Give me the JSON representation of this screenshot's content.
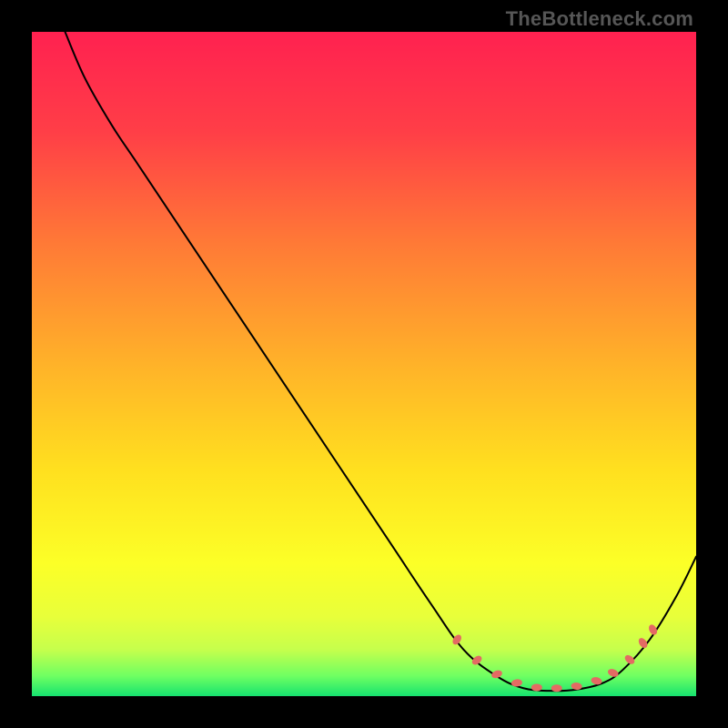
{
  "watermark": "TheBottleneck.com",
  "plot_size": 730,
  "chart_data": {
    "type": "line",
    "title": "",
    "xlabel": "",
    "ylabel": "",
    "xlim": [
      0,
      100
    ],
    "ylim": [
      0,
      100
    ],
    "grid": false,
    "background_gradient": [
      {
        "pct": 0.0,
        "color": "#ff2150"
      },
      {
        "pct": 0.15,
        "color": "#ff3e47"
      },
      {
        "pct": 0.32,
        "color": "#ff7a36"
      },
      {
        "pct": 0.5,
        "color": "#ffb229"
      },
      {
        "pct": 0.66,
        "color": "#ffe01f"
      },
      {
        "pct": 0.8,
        "color": "#fcff27"
      },
      {
        "pct": 0.88,
        "color": "#e8ff3a"
      },
      {
        "pct": 0.93,
        "color": "#c6ff4c"
      },
      {
        "pct": 0.97,
        "color": "#6eff62"
      },
      {
        "pct": 1.0,
        "color": "#16e36f"
      }
    ],
    "series": [
      {
        "name": "curve",
        "color": "#000000",
        "width": 2,
        "points": [
          {
            "x": 5.0,
            "y": 100.0
          },
          {
            "x": 8.0,
            "y": 93.0
          },
          {
            "x": 12.0,
            "y": 86.0
          },
          {
            "x": 16.0,
            "y": 80.0
          },
          {
            "x": 22.0,
            "y": 71.0
          },
          {
            "x": 30.0,
            "y": 59.0
          },
          {
            "x": 38.0,
            "y": 47.0
          },
          {
            "x": 46.0,
            "y": 35.0
          },
          {
            "x": 54.0,
            "y": 23.0
          },
          {
            "x": 60.0,
            "y": 14.0
          },
          {
            "x": 65.0,
            "y": 7.0
          },
          {
            "x": 70.0,
            "y": 3.0
          },
          {
            "x": 74.0,
            "y": 1.2
          },
          {
            "x": 78.0,
            "y": 0.8
          },
          {
            "x": 82.0,
            "y": 1.0
          },
          {
            "x": 86.0,
            "y": 2.0
          },
          {
            "x": 89.0,
            "y": 4.0
          },
          {
            "x": 93.0,
            "y": 8.5
          },
          {
            "x": 97.0,
            "y": 15.0
          },
          {
            "x": 100.0,
            "y": 21.0
          }
        ]
      }
    ],
    "markers": {
      "name": "dotted-bottom",
      "color": "#e46a63",
      "rx": 6,
      "ry": 4,
      "rotations": [
        -55,
        -40,
        -20,
        -8,
        0,
        0,
        5,
        12,
        22,
        40,
        55,
        62
      ],
      "points": [
        {
          "x": 64.0,
          "y": 8.5
        },
        {
          "x": 67.0,
          "y": 5.4
        },
        {
          "x": 70.0,
          "y": 3.3
        },
        {
          "x": 73.0,
          "y": 2.0
        },
        {
          "x": 76.0,
          "y": 1.3
        },
        {
          "x": 79.0,
          "y": 1.2
        },
        {
          "x": 82.0,
          "y": 1.5
        },
        {
          "x": 85.0,
          "y": 2.3
        },
        {
          "x": 87.5,
          "y": 3.5
        },
        {
          "x": 90.0,
          "y": 5.5
        },
        {
          "x": 92.0,
          "y": 8.0
        },
        {
          "x": 93.5,
          "y": 10.0
        }
      ]
    }
  }
}
